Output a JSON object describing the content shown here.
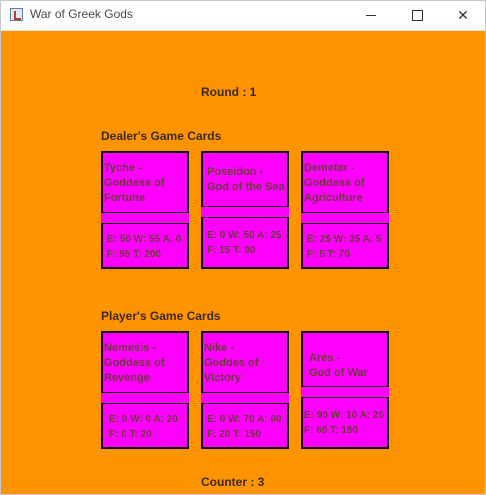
{
  "window": {
    "title": "War of Greek Gods",
    "icon": "java-cup-icon",
    "controls": {
      "minimize": "minimize-icon",
      "maximize": "maximize-icon",
      "close": "✕"
    }
  },
  "round_label": "Round : 1",
  "dealer": {
    "heading": "Dealer's Game Cards",
    "cards": [
      {
        "name": "Tyche -\nGoddess of\nFortune",
        "stats": "E: 50 W: 55 A: 0\nF: 95 T: 200"
      },
      {
        "name": "Poseidon -\nGod of the Sea",
        "stats": "E: 0 W: 50 A: 25\nF: 15 T: 90"
      },
      {
        "name": "Demeter -\nGoddess of\nAgriculture",
        "stats": "E: 25 W: 35 A: 5\nF: 5 T: 70"
      }
    ]
  },
  "player": {
    "heading": "Player's Game Cards",
    "cards": [
      {
        "name": "Nemesis -\nGoddess of\nRevenge",
        "stats": "E: 0 W: 0 A: 20\nF: 0 T: 20"
      },
      {
        "name": "Nike -\nGoddes of\nVictory",
        "stats": "E: 0 W: 70 A: 60\nF: 20 T: 150"
      },
      {
        "name": "Ares -\nGod of War",
        "stats": "E: 90 W: 10 A: 20\nF: 60 T: 180"
      }
    ]
  },
  "counter_label": "Counter : 3",
  "colors": {
    "background": "#ff9400",
    "card": "#ff00ff",
    "card_border": "#111111"
  }
}
